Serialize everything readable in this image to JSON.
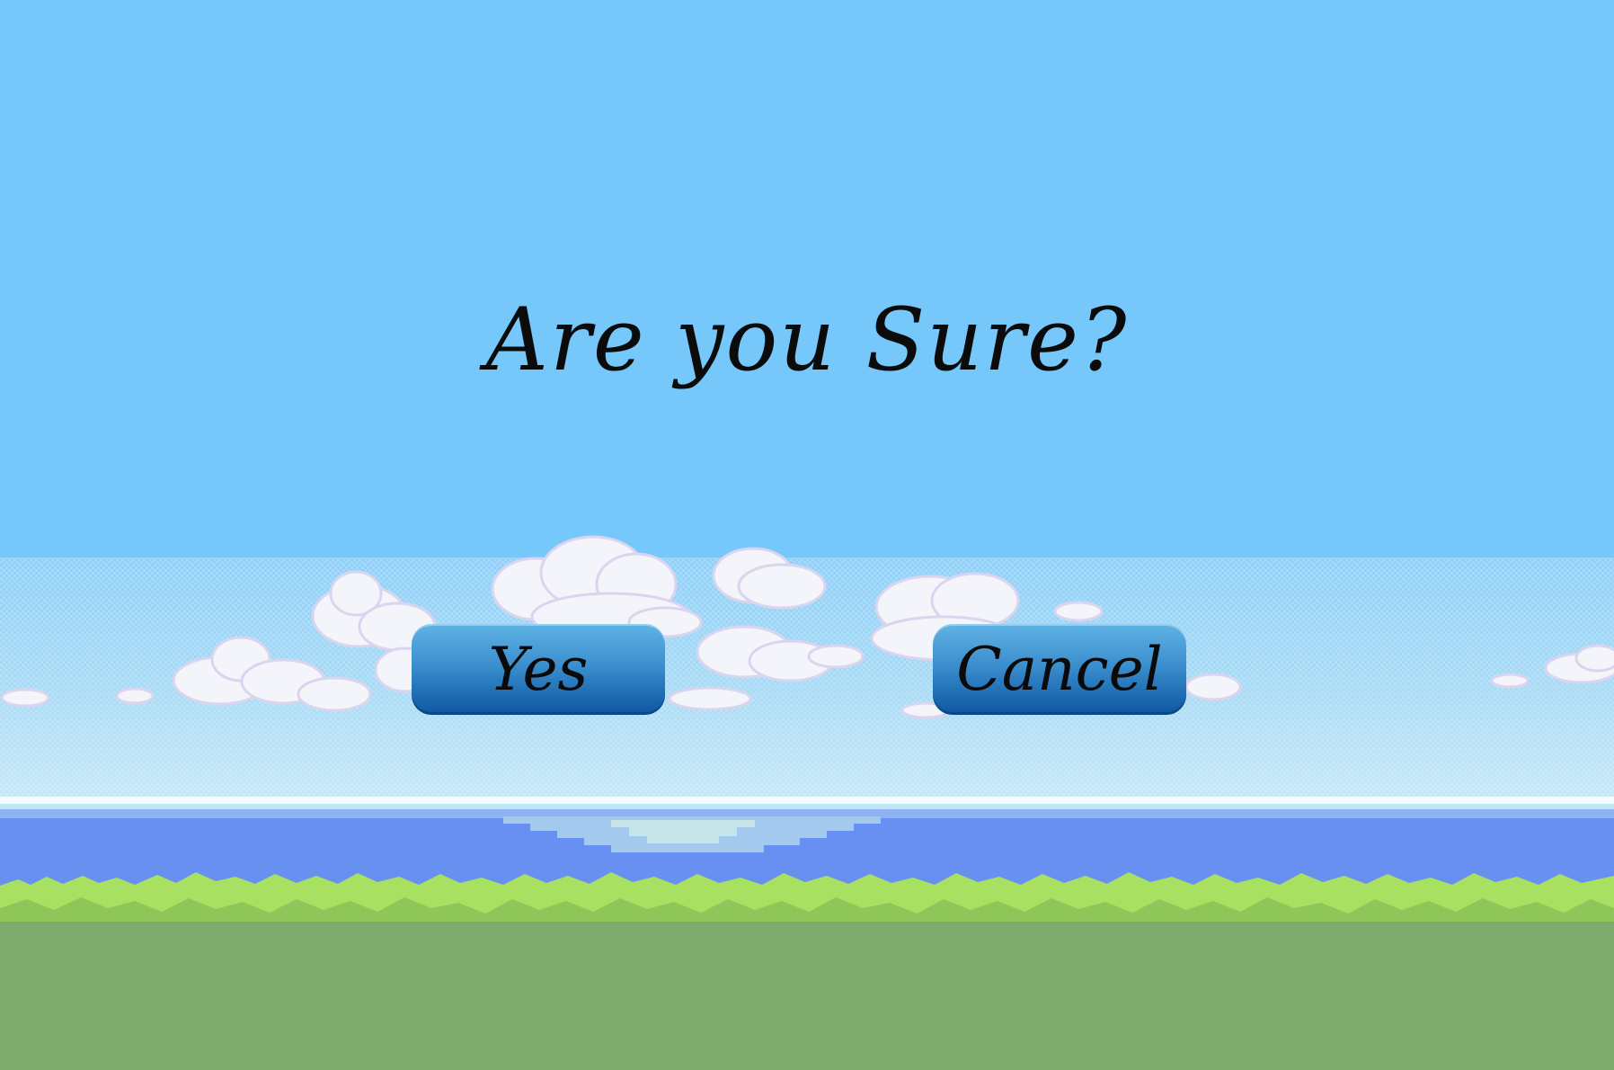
{
  "dialog": {
    "prompt": "Are you Sure?",
    "yes_label": "Yes",
    "cancel_label": "Cancel"
  },
  "colors": {
    "sky": "#76c8fa",
    "haze": "#a9dcf8",
    "sea": "#6890f0",
    "grass_light": "#a8e060",
    "grass_dark": "#7fac6e",
    "button": "#2d7fc2"
  }
}
